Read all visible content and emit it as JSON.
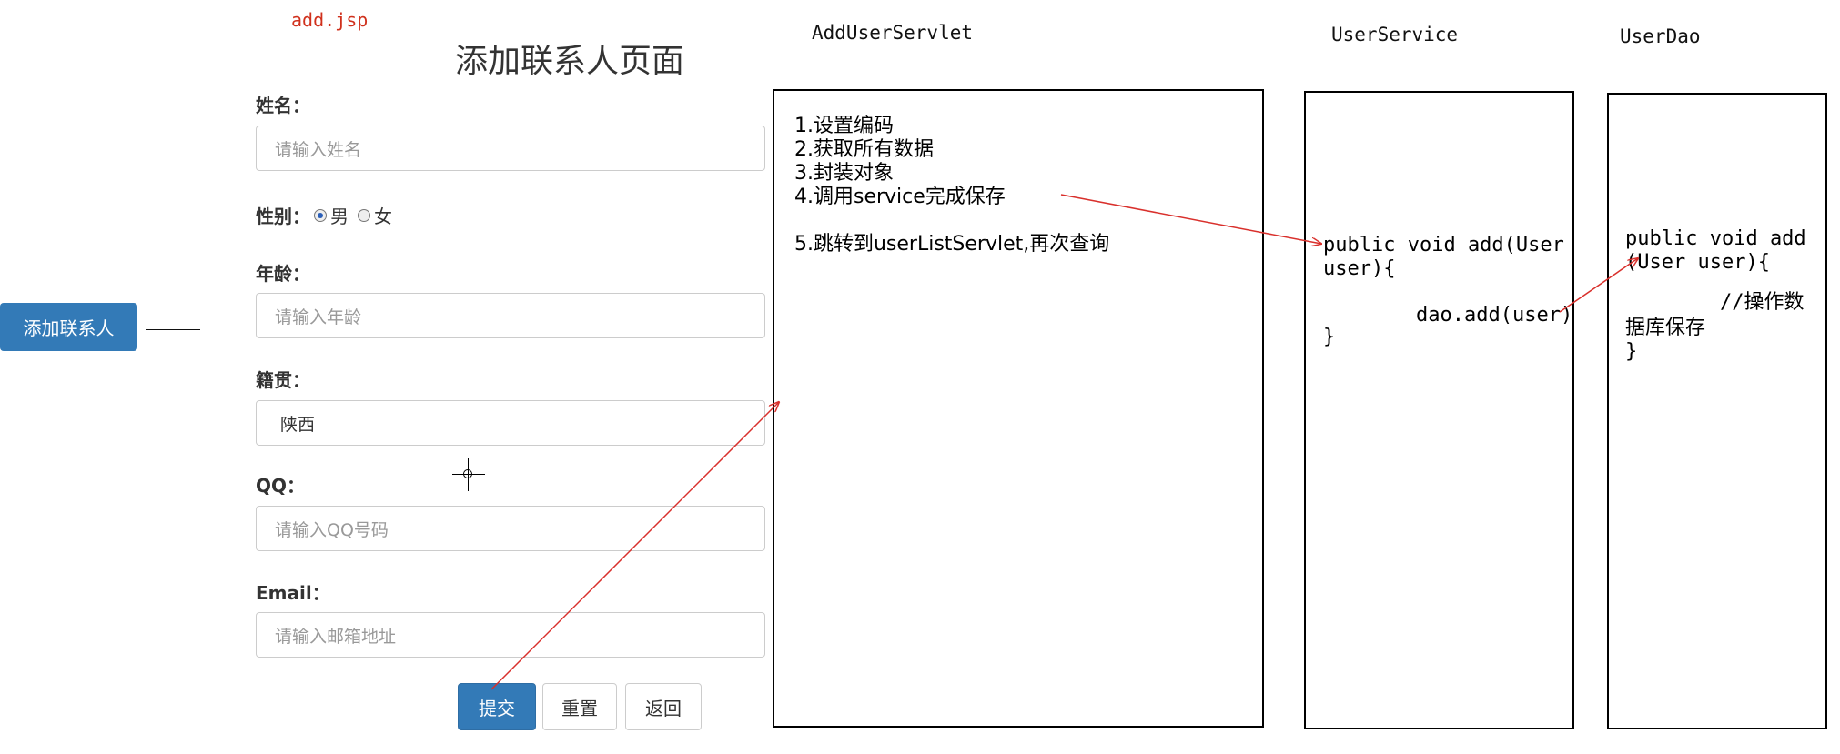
{
  "left_button": {
    "label": "添加联系人"
  },
  "form": {
    "file_label": "add.jsp",
    "title": "添加联系人页面",
    "name": {
      "label": "姓名：",
      "placeholder": "请输入姓名"
    },
    "gender": {
      "label": "性别：",
      "options": [
        "男",
        "女"
      ],
      "selected": "男"
    },
    "age": {
      "label": "年龄：",
      "placeholder": "请输入年龄"
    },
    "native": {
      "label": "籍贯：",
      "value": "陕西"
    },
    "qq": {
      "label": "QQ：",
      "placeholder": "请输入QQ号码"
    },
    "email": {
      "label": "Email：",
      "placeholder": "请输入邮箱地址"
    },
    "buttons": {
      "submit": "提交",
      "reset": "重置",
      "back": "返回"
    }
  },
  "servlet": {
    "title": "AddUserServlet",
    "steps": [
      "1.设置编码",
      "2.获取所有数据",
      "3.封装对象",
      "4.调用service完成保存",
      "5.跳转到userListServlet,再次查询"
    ]
  },
  "service": {
    "title": "UserService",
    "code_line1": "public void add(User",
    "code_line2": "user){",
    "code_line3": "dao.add(user)",
    "code_line4": "}"
  },
  "dao": {
    "title": "UserDao",
    "code_line1": "public void add",
    "code_line2": "(User user){",
    "code_line3": "//操作数",
    "code_line4": "据库保存",
    "code_line5": "}"
  },
  "colors": {
    "arrow": "#d9302c",
    "primary": "#337ab7"
  }
}
